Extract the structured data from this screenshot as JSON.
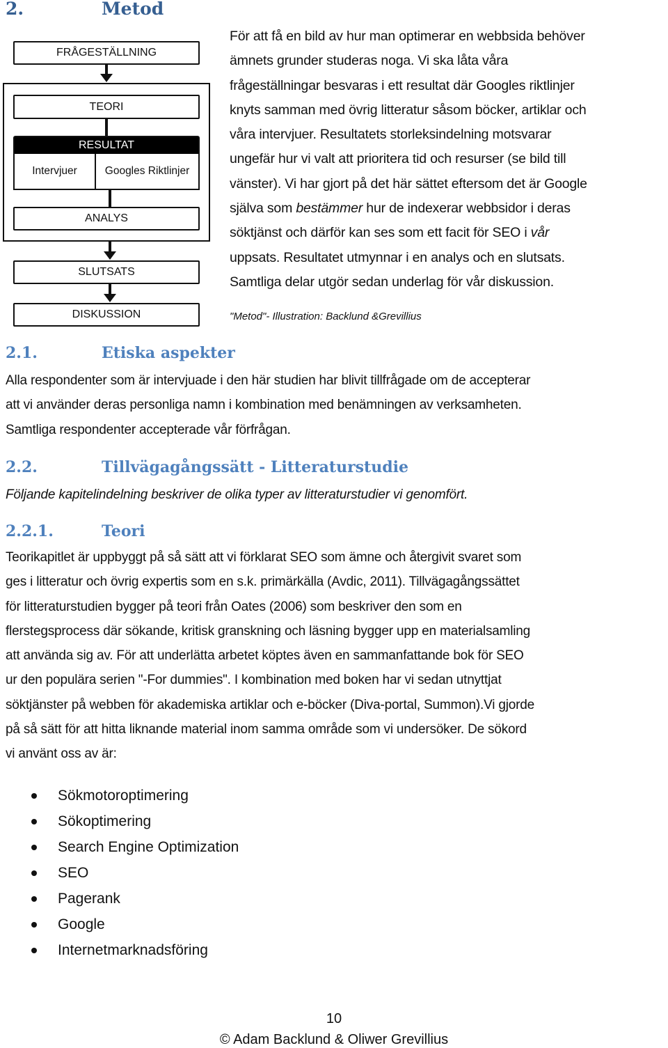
{
  "heading_main": {
    "number": "2.",
    "title": "Metod"
  },
  "diagram": {
    "question": "FRÅGESTÄLLNING",
    "theory": "TEORI",
    "result": "RESULTAT",
    "interviews": "Intervjuer",
    "guidelines": "Googles Riktlinjer",
    "analysis": "ANALYS",
    "conclusion": "SLUTSATS",
    "discussion": "DISKUSSION"
  },
  "intro": {
    "lines": [
      "För att få en bild av hur man optimerar en webbsida behöver",
      "ämnets grunder studeras noga. Vi ska låta våra",
      "frågeställningar besvaras i ett resultat där Googles riktlinjer",
      "knyts samman med övrig litteratur såsom böcker, artiklar och",
      "våra intervjuer. Resultatets storleksindelning motsvarar",
      "ungefär hur vi valt att prioritera tid och resurser (se bild till",
      "vänster). Vi har gjort på det här sättet eftersom det är Google"
    ],
    "line8_pre": "själva som ",
    "line8_em": "bestämmer",
    "line8_post": " hur de indexerar webbsidor i deras",
    "line9_pre": "söktjänst och därför kan ses som ett facit för SEO i ",
    "line9_em": "vår",
    "lines_end": [
      "uppsats. Resultatet utmynnar i en analys och en slutsats.",
      "Samtliga delar utgör sedan underlag för vår diskussion."
    ],
    "caption": "\"Metod\"- Illustration: Backlund &Grevillius"
  },
  "section_2_1": {
    "number": "2.1.",
    "title": "Etiska aspekter",
    "lines": [
      "Alla respondenter som är intervjuade i den här studien har blivit tillfrågade om de accepterar",
      "att vi använder deras personliga namn i kombination med benämningen av verksamheten.",
      "Samtliga respondenter accepterade vår förfrågan."
    ]
  },
  "section_2_2": {
    "number": "2.2.",
    "title": "Tillvägagångssätt - Litteraturstudie",
    "intro": "Följande kapitelindelning beskriver de olika typer av litteraturstudier vi genomfört."
  },
  "section_2_2_1": {
    "number": "2.2.1.",
    "title": "Teori",
    "lines": [
      "Teorikapitlet är uppbyggt på så sätt att vi förklarat SEO som ämne och återgivit svaret som",
      "ges i litteratur och övrig expertis som en s.k. primärkälla (Avdic, 2011). Tillvägagångssättet",
      "för litteraturstudien bygger på teori från Oates (2006) som beskriver den som en",
      "flerstegsprocess där sökande, kritisk granskning och läsning bygger upp en materialsamling",
      "att använda sig av. För att underlätta arbetet köptes även en sammanfattande bok för SEO",
      "ur den populära serien \"-For dummies\". I kombination med boken har vi sedan utnyttjat",
      "söktjänster på webben för akademiska artiklar och e-böcker (Diva-portal, Summon).Vi gjorde",
      "på så sätt för att hitta liknande material inom samma område som vi undersöker. De sökord",
      "vi använt oss av är:"
    ],
    "keywords": [
      "Sökmotoroptimering",
      "Sökoptimering",
      "Search Engine Optimization",
      "SEO",
      "Pagerank",
      "Google",
      "Internetmarknadsföring"
    ]
  },
  "footer": {
    "page_number": "10",
    "copyright": "© Adam Backlund & Oliwer Grevillius"
  }
}
